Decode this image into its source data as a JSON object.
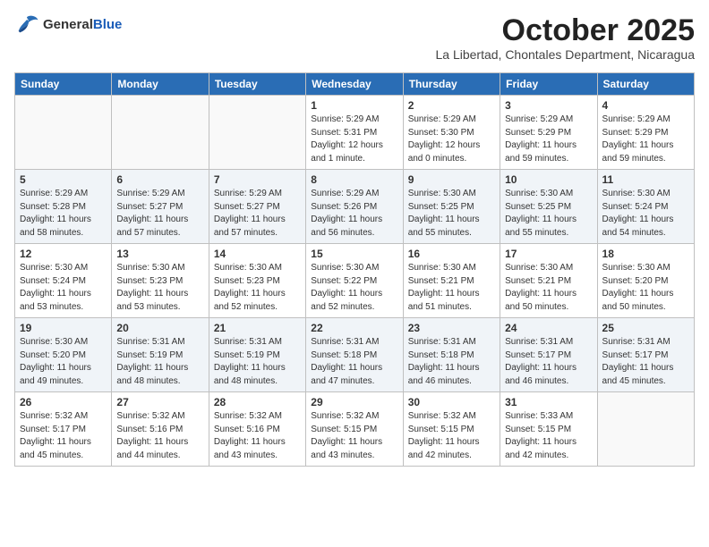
{
  "header": {
    "logo_general": "General",
    "logo_blue": "Blue",
    "month_title": "October 2025",
    "subtitle": "La Libertad, Chontales Department, Nicaragua"
  },
  "days_of_week": [
    "Sunday",
    "Monday",
    "Tuesday",
    "Wednesday",
    "Thursday",
    "Friday",
    "Saturday"
  ],
  "weeks": [
    [
      {
        "day": "",
        "info": ""
      },
      {
        "day": "",
        "info": ""
      },
      {
        "day": "",
        "info": ""
      },
      {
        "day": "1",
        "info": "Sunrise: 5:29 AM\nSunset: 5:31 PM\nDaylight: 12 hours\nand 1 minute."
      },
      {
        "day": "2",
        "info": "Sunrise: 5:29 AM\nSunset: 5:30 PM\nDaylight: 12 hours\nand 0 minutes."
      },
      {
        "day": "3",
        "info": "Sunrise: 5:29 AM\nSunset: 5:29 PM\nDaylight: 11 hours\nand 59 minutes."
      },
      {
        "day": "4",
        "info": "Sunrise: 5:29 AM\nSunset: 5:29 PM\nDaylight: 11 hours\nand 59 minutes."
      }
    ],
    [
      {
        "day": "5",
        "info": "Sunrise: 5:29 AM\nSunset: 5:28 PM\nDaylight: 11 hours\nand 58 minutes."
      },
      {
        "day": "6",
        "info": "Sunrise: 5:29 AM\nSunset: 5:27 PM\nDaylight: 11 hours\nand 57 minutes."
      },
      {
        "day": "7",
        "info": "Sunrise: 5:29 AM\nSunset: 5:27 PM\nDaylight: 11 hours\nand 57 minutes."
      },
      {
        "day": "8",
        "info": "Sunrise: 5:29 AM\nSunset: 5:26 PM\nDaylight: 11 hours\nand 56 minutes."
      },
      {
        "day": "9",
        "info": "Sunrise: 5:30 AM\nSunset: 5:25 PM\nDaylight: 11 hours\nand 55 minutes."
      },
      {
        "day": "10",
        "info": "Sunrise: 5:30 AM\nSunset: 5:25 PM\nDaylight: 11 hours\nand 55 minutes."
      },
      {
        "day": "11",
        "info": "Sunrise: 5:30 AM\nSunset: 5:24 PM\nDaylight: 11 hours\nand 54 minutes."
      }
    ],
    [
      {
        "day": "12",
        "info": "Sunrise: 5:30 AM\nSunset: 5:24 PM\nDaylight: 11 hours\nand 53 minutes."
      },
      {
        "day": "13",
        "info": "Sunrise: 5:30 AM\nSunset: 5:23 PM\nDaylight: 11 hours\nand 53 minutes."
      },
      {
        "day": "14",
        "info": "Sunrise: 5:30 AM\nSunset: 5:23 PM\nDaylight: 11 hours\nand 52 minutes."
      },
      {
        "day": "15",
        "info": "Sunrise: 5:30 AM\nSunset: 5:22 PM\nDaylight: 11 hours\nand 52 minutes."
      },
      {
        "day": "16",
        "info": "Sunrise: 5:30 AM\nSunset: 5:21 PM\nDaylight: 11 hours\nand 51 minutes."
      },
      {
        "day": "17",
        "info": "Sunrise: 5:30 AM\nSunset: 5:21 PM\nDaylight: 11 hours\nand 50 minutes."
      },
      {
        "day": "18",
        "info": "Sunrise: 5:30 AM\nSunset: 5:20 PM\nDaylight: 11 hours\nand 50 minutes."
      }
    ],
    [
      {
        "day": "19",
        "info": "Sunrise: 5:30 AM\nSunset: 5:20 PM\nDaylight: 11 hours\nand 49 minutes."
      },
      {
        "day": "20",
        "info": "Sunrise: 5:31 AM\nSunset: 5:19 PM\nDaylight: 11 hours\nand 48 minutes."
      },
      {
        "day": "21",
        "info": "Sunrise: 5:31 AM\nSunset: 5:19 PM\nDaylight: 11 hours\nand 48 minutes."
      },
      {
        "day": "22",
        "info": "Sunrise: 5:31 AM\nSunset: 5:18 PM\nDaylight: 11 hours\nand 47 minutes."
      },
      {
        "day": "23",
        "info": "Sunrise: 5:31 AM\nSunset: 5:18 PM\nDaylight: 11 hours\nand 46 minutes."
      },
      {
        "day": "24",
        "info": "Sunrise: 5:31 AM\nSunset: 5:17 PM\nDaylight: 11 hours\nand 46 minutes."
      },
      {
        "day": "25",
        "info": "Sunrise: 5:31 AM\nSunset: 5:17 PM\nDaylight: 11 hours\nand 45 minutes."
      }
    ],
    [
      {
        "day": "26",
        "info": "Sunrise: 5:32 AM\nSunset: 5:17 PM\nDaylight: 11 hours\nand 45 minutes."
      },
      {
        "day": "27",
        "info": "Sunrise: 5:32 AM\nSunset: 5:16 PM\nDaylight: 11 hours\nand 44 minutes."
      },
      {
        "day": "28",
        "info": "Sunrise: 5:32 AM\nSunset: 5:16 PM\nDaylight: 11 hours\nand 43 minutes."
      },
      {
        "day": "29",
        "info": "Sunrise: 5:32 AM\nSunset: 5:15 PM\nDaylight: 11 hours\nand 43 minutes."
      },
      {
        "day": "30",
        "info": "Sunrise: 5:32 AM\nSunset: 5:15 PM\nDaylight: 11 hours\nand 42 minutes."
      },
      {
        "day": "31",
        "info": "Sunrise: 5:33 AM\nSunset: 5:15 PM\nDaylight: 11 hours\nand 42 minutes."
      },
      {
        "day": "",
        "info": ""
      }
    ]
  ]
}
